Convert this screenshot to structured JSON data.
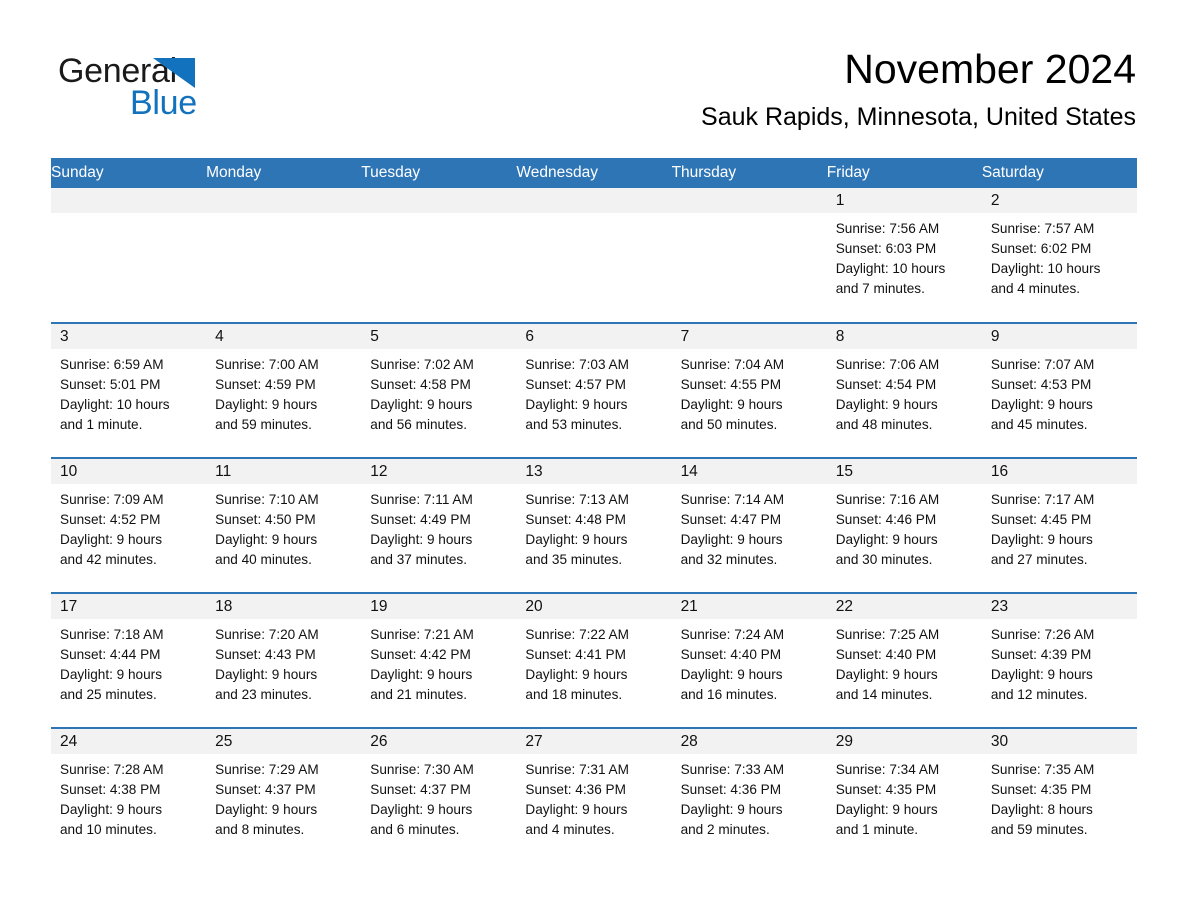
{
  "brand": {
    "name_part1": "General",
    "name_part2": "Blue",
    "accent_color": "#1272bd"
  },
  "header": {
    "month_title": "November 2024",
    "location": "Sauk Rapids, Minnesota, United States"
  },
  "calendar": {
    "header_bg": "#2e75b6",
    "daynum_bg": "#f2f2f2",
    "weekdays": [
      "Sunday",
      "Monday",
      "Tuesday",
      "Wednesday",
      "Thursday",
      "Friday",
      "Saturday"
    ],
    "weeks": [
      [
        {
          "day": "",
          "lines": []
        },
        {
          "day": "",
          "lines": []
        },
        {
          "day": "",
          "lines": []
        },
        {
          "day": "",
          "lines": []
        },
        {
          "day": "",
          "lines": []
        },
        {
          "day": "1",
          "lines": [
            "Sunrise: 7:56 AM",
            "Sunset: 6:03 PM",
            "Daylight: 10 hours",
            "and 7 minutes."
          ]
        },
        {
          "day": "2",
          "lines": [
            "Sunrise: 7:57 AM",
            "Sunset: 6:02 PM",
            "Daylight: 10 hours",
            "and 4 minutes."
          ]
        }
      ],
      [
        {
          "day": "3",
          "lines": [
            "Sunrise: 6:59 AM",
            "Sunset: 5:01 PM",
            "Daylight: 10 hours",
            "and 1 minute."
          ]
        },
        {
          "day": "4",
          "lines": [
            "Sunrise: 7:00 AM",
            "Sunset: 4:59 PM",
            "Daylight: 9 hours",
            "and 59 minutes."
          ]
        },
        {
          "day": "5",
          "lines": [
            "Sunrise: 7:02 AM",
            "Sunset: 4:58 PM",
            "Daylight: 9 hours",
            "and 56 minutes."
          ]
        },
        {
          "day": "6",
          "lines": [
            "Sunrise: 7:03 AM",
            "Sunset: 4:57 PM",
            "Daylight: 9 hours",
            "and 53 minutes."
          ]
        },
        {
          "day": "7",
          "lines": [
            "Sunrise: 7:04 AM",
            "Sunset: 4:55 PM",
            "Daylight: 9 hours",
            "and 50 minutes."
          ]
        },
        {
          "day": "8",
          "lines": [
            "Sunrise: 7:06 AM",
            "Sunset: 4:54 PM",
            "Daylight: 9 hours",
            "and 48 minutes."
          ]
        },
        {
          "day": "9",
          "lines": [
            "Sunrise: 7:07 AM",
            "Sunset: 4:53 PM",
            "Daylight: 9 hours",
            "and 45 minutes."
          ]
        }
      ],
      [
        {
          "day": "10",
          "lines": [
            "Sunrise: 7:09 AM",
            "Sunset: 4:52 PM",
            "Daylight: 9 hours",
            "and 42 minutes."
          ]
        },
        {
          "day": "11",
          "lines": [
            "Sunrise: 7:10 AM",
            "Sunset: 4:50 PM",
            "Daylight: 9 hours",
            "and 40 minutes."
          ]
        },
        {
          "day": "12",
          "lines": [
            "Sunrise: 7:11 AM",
            "Sunset: 4:49 PM",
            "Daylight: 9 hours",
            "and 37 minutes."
          ]
        },
        {
          "day": "13",
          "lines": [
            "Sunrise: 7:13 AM",
            "Sunset: 4:48 PM",
            "Daylight: 9 hours",
            "and 35 minutes."
          ]
        },
        {
          "day": "14",
          "lines": [
            "Sunrise: 7:14 AM",
            "Sunset: 4:47 PM",
            "Daylight: 9 hours",
            "and 32 minutes."
          ]
        },
        {
          "day": "15",
          "lines": [
            "Sunrise: 7:16 AM",
            "Sunset: 4:46 PM",
            "Daylight: 9 hours",
            "and 30 minutes."
          ]
        },
        {
          "day": "16",
          "lines": [
            "Sunrise: 7:17 AM",
            "Sunset: 4:45 PM",
            "Daylight: 9 hours",
            "and 27 minutes."
          ]
        }
      ],
      [
        {
          "day": "17",
          "lines": [
            "Sunrise: 7:18 AM",
            "Sunset: 4:44 PM",
            "Daylight: 9 hours",
            "and 25 minutes."
          ]
        },
        {
          "day": "18",
          "lines": [
            "Sunrise: 7:20 AM",
            "Sunset: 4:43 PM",
            "Daylight: 9 hours",
            "and 23 minutes."
          ]
        },
        {
          "day": "19",
          "lines": [
            "Sunrise: 7:21 AM",
            "Sunset: 4:42 PM",
            "Daylight: 9 hours",
            "and 21 minutes."
          ]
        },
        {
          "day": "20",
          "lines": [
            "Sunrise: 7:22 AM",
            "Sunset: 4:41 PM",
            "Daylight: 9 hours",
            "and 18 minutes."
          ]
        },
        {
          "day": "21",
          "lines": [
            "Sunrise: 7:24 AM",
            "Sunset: 4:40 PM",
            "Daylight: 9 hours",
            "and 16 minutes."
          ]
        },
        {
          "day": "22",
          "lines": [
            "Sunrise: 7:25 AM",
            "Sunset: 4:40 PM",
            "Daylight: 9 hours",
            "and 14 minutes."
          ]
        },
        {
          "day": "23",
          "lines": [
            "Sunrise: 7:26 AM",
            "Sunset: 4:39 PM",
            "Daylight: 9 hours",
            "and 12 minutes."
          ]
        }
      ],
      [
        {
          "day": "24",
          "lines": [
            "Sunrise: 7:28 AM",
            "Sunset: 4:38 PM",
            "Daylight: 9 hours",
            "and 10 minutes."
          ]
        },
        {
          "day": "25",
          "lines": [
            "Sunrise: 7:29 AM",
            "Sunset: 4:37 PM",
            "Daylight: 9 hours",
            "and 8 minutes."
          ]
        },
        {
          "day": "26",
          "lines": [
            "Sunrise: 7:30 AM",
            "Sunset: 4:37 PM",
            "Daylight: 9 hours",
            "and 6 minutes."
          ]
        },
        {
          "day": "27",
          "lines": [
            "Sunrise: 7:31 AM",
            "Sunset: 4:36 PM",
            "Daylight: 9 hours",
            "and 4 minutes."
          ]
        },
        {
          "day": "28",
          "lines": [
            "Sunrise: 7:33 AM",
            "Sunset: 4:36 PM",
            "Daylight: 9 hours",
            "and 2 minutes."
          ]
        },
        {
          "day": "29",
          "lines": [
            "Sunrise: 7:34 AM",
            "Sunset: 4:35 PM",
            "Daylight: 9 hours",
            "and 1 minute."
          ]
        },
        {
          "day": "30",
          "lines": [
            "Sunrise: 7:35 AM",
            "Sunset: 4:35 PM",
            "Daylight: 8 hours",
            "and 59 minutes."
          ]
        }
      ]
    ]
  }
}
